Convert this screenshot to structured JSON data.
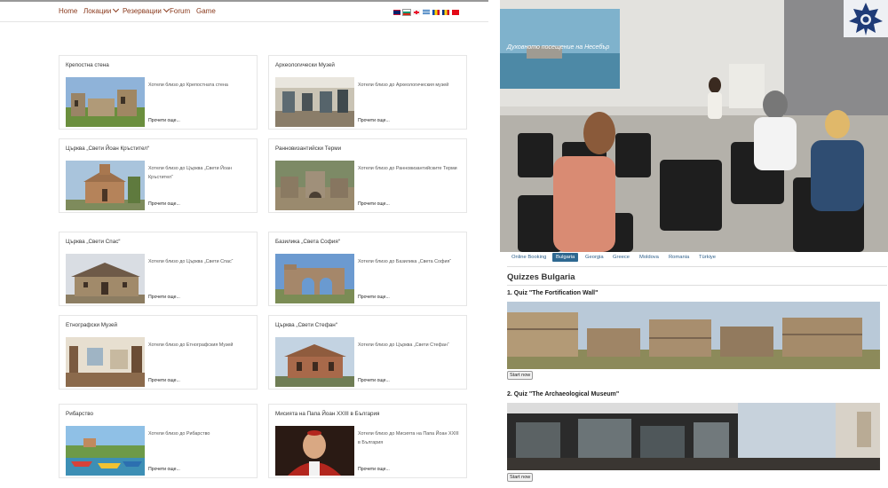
{
  "nav": {
    "items": [
      {
        "label": "Home",
        "dropdown": false
      },
      {
        "label": "Локации",
        "dropdown": true
      },
      {
        "label": "Резервации",
        "dropdown": true
      },
      {
        "label": "Forum",
        "dropdown": false
      },
      {
        "label": "Game",
        "dropdown": false
      }
    ],
    "languages": [
      "English",
      "Bulgarian",
      "Georgian",
      "Greek",
      "Moldovan",
      "Romanian",
      "Turkish"
    ]
  },
  "cards": [
    {
      "title": "Крепостна стена",
      "text": "Хотели близо до Крепостната стена",
      "more": "Прочети още...",
      "image": "fortress-wall-photo"
    },
    {
      "title": "Археологически Музей",
      "text": "Хотели близо до Археологическия музей",
      "more": "Прочети още...",
      "image": "museum-photo"
    },
    {
      "title": "Църква „Свети Йоан Кръстител“",
      "text": "Хотели близо до Църква „Свети Йоан Кръстител“",
      "more": "Прочети още...",
      "image": "church-photo"
    },
    {
      "title": "Ранновизантийски Терми",
      "text": "Хотели близо до Ранновизантийските Терми",
      "more": "Прочети още...",
      "image": "ruins-photo"
    },
    {
      "title": "Църква „Свети Спас“",
      "text": "Хотели близо до Църква „Свети Спас“",
      "more": "Прочети още...",
      "image": "church-photo"
    },
    {
      "title": "Базилика „Света София“",
      "text": "Хотели близо до Базилика „Света София“",
      "more": "Прочети още...",
      "image": "basilica-photo"
    },
    {
      "title": "Етнографски Музей",
      "text": "Хотели близо до Етнографския Музей",
      "more": "Прочети още...",
      "image": "interior-photo"
    },
    {
      "title": "Църква „Свети Стефан“",
      "text": "Хотели близо до Църква „Свети Стефан“",
      "more": "Прочети още...",
      "image": "church-photo"
    },
    {
      "title": "Рибарство",
      "text": "Хотели близо до Рибарство",
      "more": "Прочети още...",
      "image": "boats-photo"
    },
    {
      "title": "Мисията на Папа Йоан XXIII в България",
      "text": "Хотели близо до Мисията на Папа Йоан XXIII в България",
      "more": "Прочети още...",
      "image": "portrait-photo"
    }
  ],
  "seminar": {
    "screen_text": "Духовното посещение на Несебър"
  },
  "tabs": [
    {
      "label": "Online Booking",
      "active": false
    },
    {
      "label": "Bulgaria",
      "active": true
    },
    {
      "label": "Georgia",
      "active": false
    },
    {
      "label": "Greece",
      "active": false
    },
    {
      "label": "Moldova",
      "active": false
    },
    {
      "label": "Romania",
      "active": false
    },
    {
      "label": "Türkiye",
      "active": false
    }
  ],
  "quizzes": {
    "heading": "Quizzes Bulgaria",
    "items": [
      {
        "title": "1. Quiz \"The Fortification Wall\"",
        "button": "Start now",
        "image": "fortification-wall-panorama"
      },
      {
        "title": "2. Quiz \"The Archaeological Museum\"",
        "button": "Start now",
        "image": "museum-hall-panorama"
      }
    ]
  },
  "colors": {
    "nav_text": "#8a3a1d",
    "tab_active": "#2e6891",
    "tab_text": "#2d5f8a",
    "logo": "#1f3b77"
  }
}
